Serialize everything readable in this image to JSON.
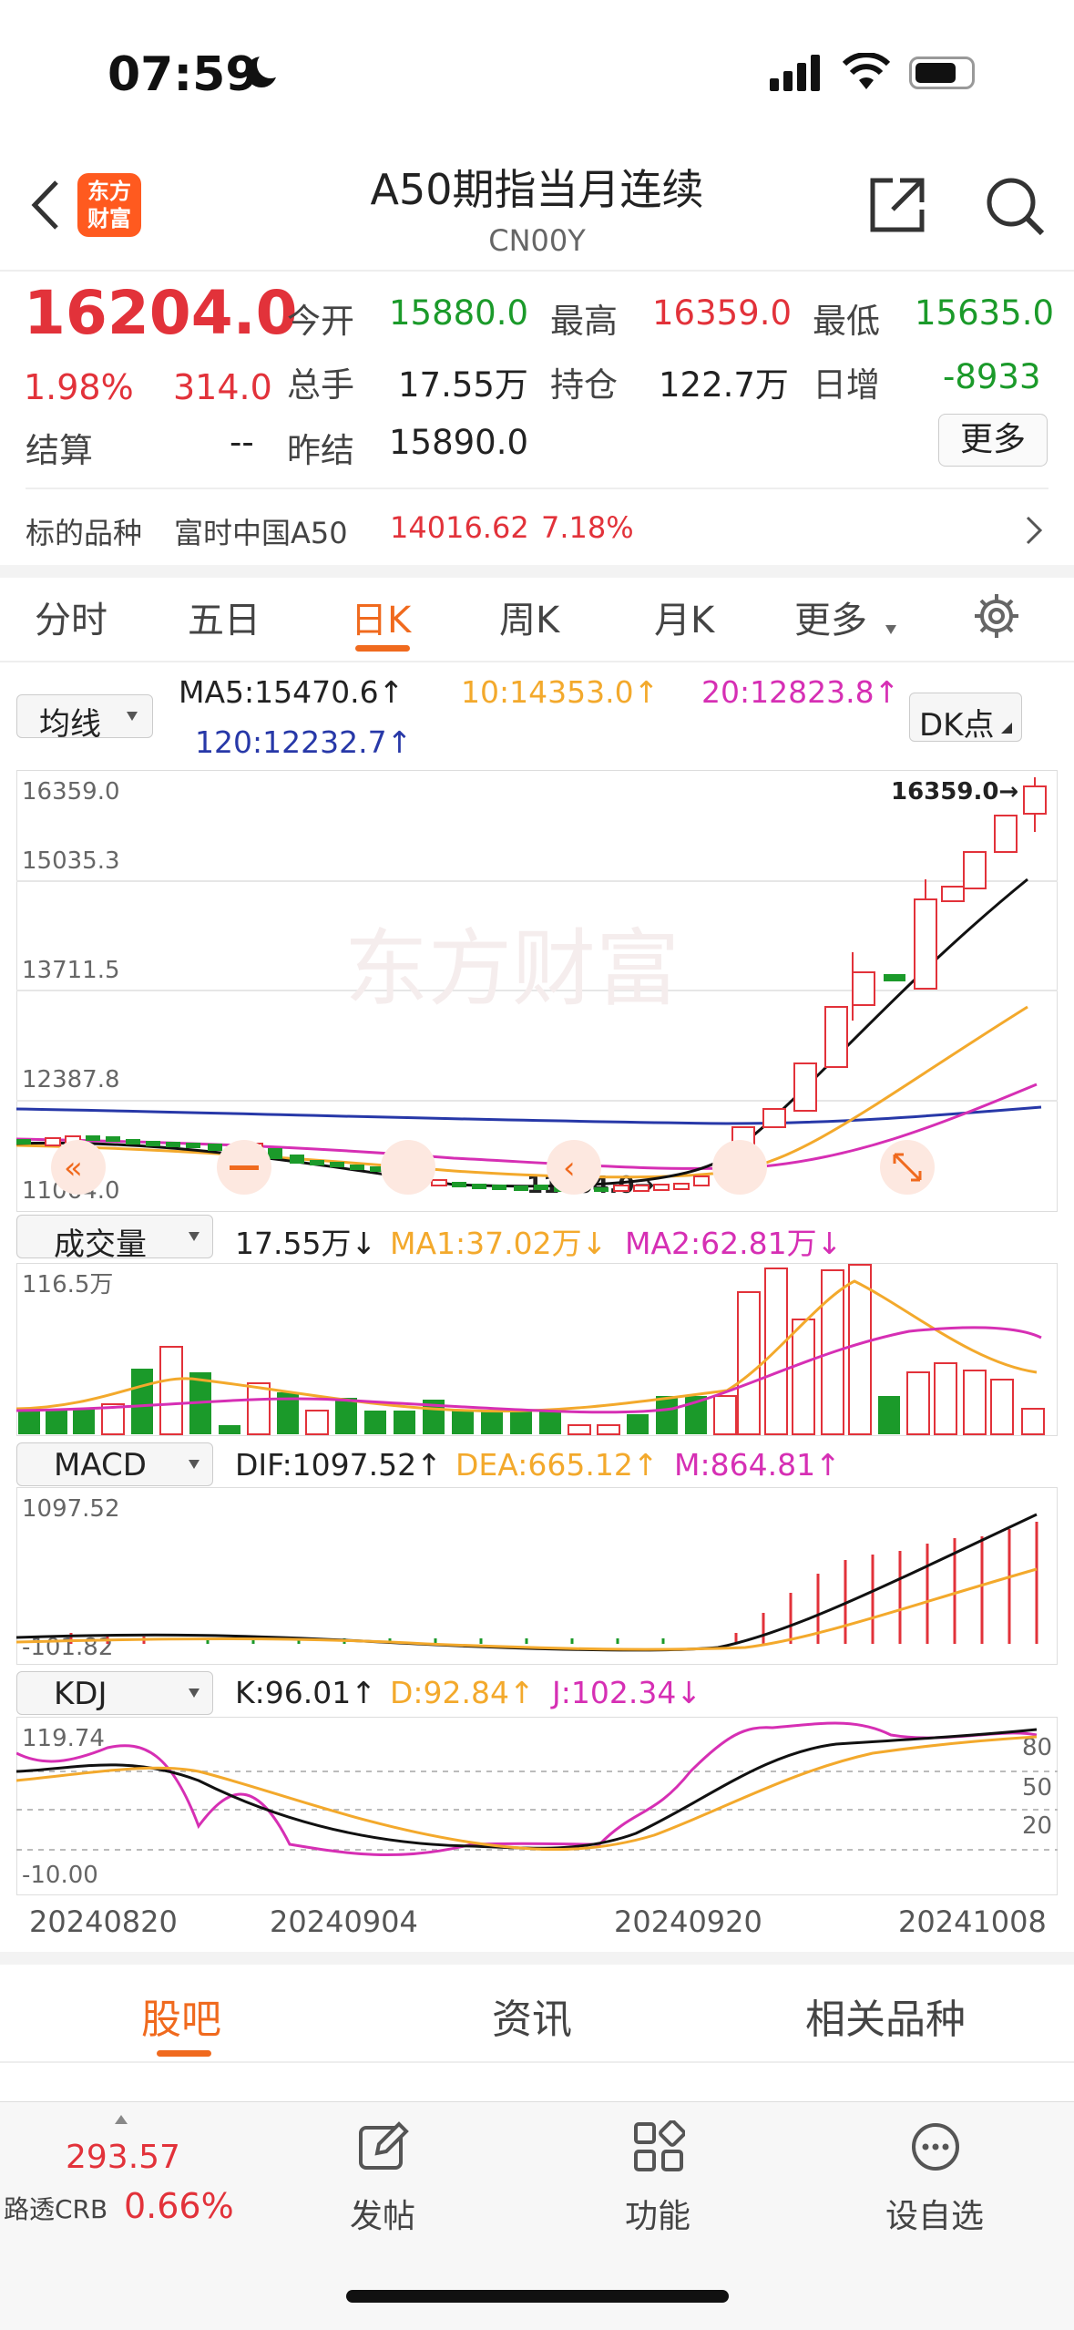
{
  "status": {
    "time": "07:59"
  },
  "header": {
    "title": "A50期指当月连续",
    "code": "CN00Y",
    "logo_text": "东方财富"
  },
  "quote": {
    "price": "16204.0",
    "change_pct": "1.98%",
    "change": "314.0",
    "open_label": "今开",
    "open": "15880.0",
    "high_label": "最高",
    "high": "16359.0",
    "low_label": "最低",
    "low": "15635.0",
    "volume_label": "总手",
    "volume": "17.55万",
    "position_label": "持仓",
    "position": "122.7万",
    "daily_inc_label": "日增",
    "daily_inc": "-8933",
    "settle_label": "结算",
    "settle": "--",
    "prev_settle_label": "昨结",
    "prev_settle": "15890.0",
    "more_label": "更多"
  },
  "underlying": {
    "label": "标的品种",
    "name": "富时中国A50",
    "price": "14016.62",
    "pct": "7.18%"
  },
  "tabs": [
    "分时",
    "五日",
    "日K",
    "周K",
    "月K",
    "更多"
  ],
  "active_tab": "日K",
  "ma_bar": {
    "selector": "均线",
    "ma5": "MA5:15470.6↑",
    "ma10": "10:14353.0↑",
    "ma20": "20:12823.8↑",
    "ma120": "120:12232.7↑",
    "dk": "DK点"
  },
  "kline": {
    "yticks": [
      "16359.0",
      "15035.3",
      "13711.5",
      "12387.8",
      "11064.0"
    ],
    "high_marker": "16359.0→",
    "low_marker": "11064.0→",
    "watermark": "东方财富"
  },
  "volume_panel": {
    "selector": "成交量",
    "value": "17.55万↓",
    "ma1": "MA1:37.02万↓",
    "ma2": "MA2:62.81万↓",
    "ytick": "116.5万"
  },
  "macd_panel": {
    "selector": "MACD",
    "dif": "DIF:1097.52↑",
    "dea": "DEA:665.12↑",
    "m": "M:864.81↑",
    "ytop": "1097.52",
    "ybot": "-101.82"
  },
  "kdj_panel": {
    "selector": "KDJ",
    "k": "K:96.01↑",
    "d": "D:92.84↑",
    "j": "J:102.34↓",
    "ytop": "119.74",
    "ybot": "-10.00",
    "levels": [
      "80",
      "50",
      "20"
    ]
  },
  "x_dates": [
    "20240820",
    "20240904",
    "20240920",
    "20241008"
  ],
  "section_tabs": [
    "股吧",
    "资讯",
    "相关品种"
  ],
  "bottom_nav": {
    "crb_value": "293.57",
    "crb_label": "路透CRB",
    "crb_pct": "0.66%",
    "items": [
      "发帖",
      "功能",
      "设自选"
    ]
  },
  "colors": {
    "up": "#e2323a",
    "down": "#1b9a2a",
    "accent": "#f06a1e",
    "ma10": "#f3a92c",
    "ma20": "#d62fb4",
    "ma120": "#2738a8"
  }
}
